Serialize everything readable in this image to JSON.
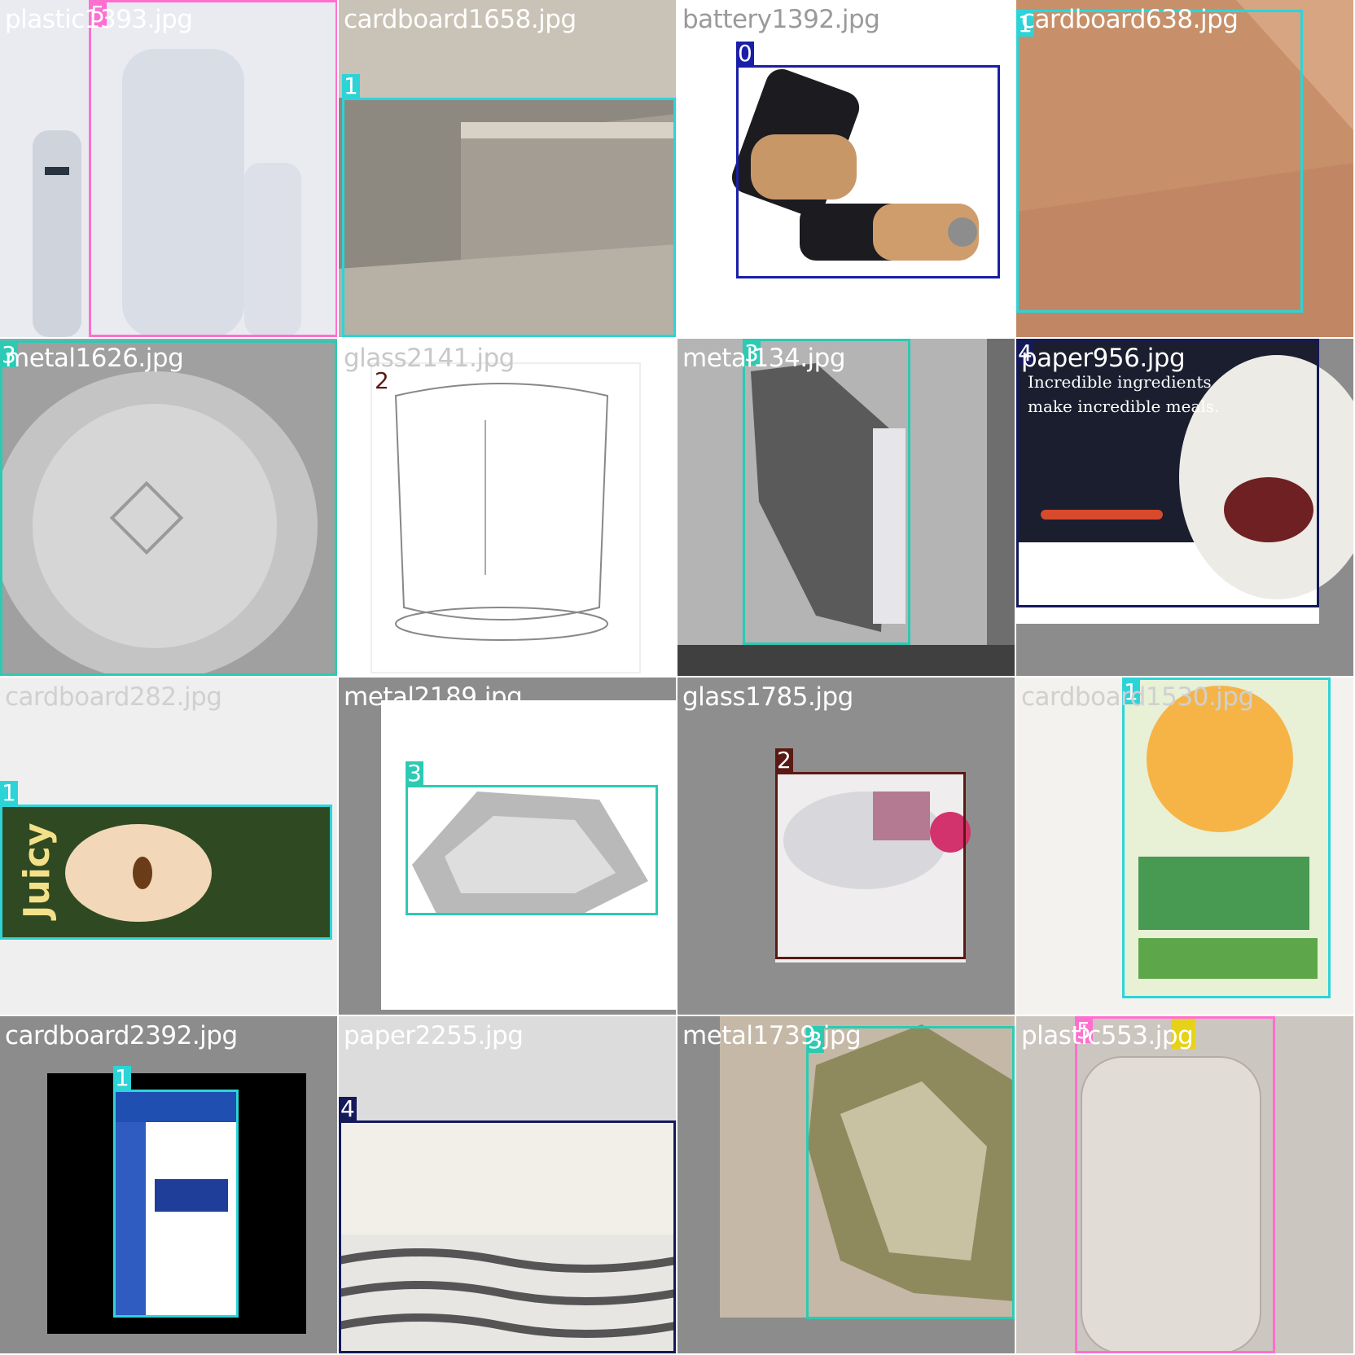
{
  "title": "",
  "class_colors": {
    "0": "#1a1fa8",
    "1": "#2cd4d8",
    "2": "#5a1a14",
    "3": "#2ccab3",
    "4": "#14195a",
    "5": "#ff6fd0"
  },
  "tiles": [
    {
      "filename": "plastic1393.jpg",
      "label_color": "#ffffff",
      "bg": "#e8e9ef",
      "boxes": [
        {
          "class_id": "5"
        }
      ]
    },
    {
      "filename": "cardboard1658.jpg",
      "label_color": "#ffffff",
      "bg": "#a8a39b",
      "boxes": [
        {
          "class_id": "1"
        }
      ]
    },
    {
      "filename": "battery1392.jpg",
      "label_color": "#9a9a9a",
      "bg": "#ffffff",
      "boxes": [
        {
          "class_id": "0"
        }
      ]
    },
    {
      "filename": "cardboard638.jpg",
      "label_color": "#ffffff",
      "bg": "#c48a64",
      "boxes": [
        {
          "class_id": "1"
        }
      ]
    },
    {
      "filename": "metal1626.jpg",
      "label_color": "#ffffff",
      "bg": "#9c9c9c",
      "boxes": [
        {
          "class_id": "3"
        }
      ]
    },
    {
      "filename": "glass2141.jpg",
      "label_color": "#c8c8c8",
      "bg": "#ffffff",
      "boxes": [
        {
          "class_id": "2"
        }
      ]
    },
    {
      "filename": "metal134.jpg",
      "label_color": "#ffffff",
      "bg": "#b4b4b4",
      "boxes": [
        {
          "class_id": "3"
        }
      ]
    },
    {
      "filename": "paper956.jpg",
      "label_color": "#ffffff",
      "bg": "#8c8c8c",
      "boxes": [
        {
          "class_id": "4"
        }
      ]
    },
    {
      "filename": "cardboard282.jpg",
      "label_color": "#d0d0d0",
      "bg": "#efefef",
      "boxes": [
        {
          "class_id": "1"
        }
      ]
    },
    {
      "filename": "metal2189.jpg",
      "label_color": "#ffffff",
      "bg": "#8c8c8c",
      "boxes": [
        {
          "class_id": "3"
        }
      ]
    },
    {
      "filename": "glass1785.jpg",
      "label_color": "#ffffff",
      "bg": "#8e8e8e",
      "boxes": [
        {
          "class_id": "2"
        }
      ]
    },
    {
      "filename": "cardboard1530.jpg",
      "label_color": "#d0d0d0",
      "bg": "#f4f2ee",
      "boxes": [
        {
          "class_id": "1"
        }
      ]
    },
    {
      "filename": "cardboard2392.jpg",
      "label_color": "#ffffff",
      "bg": "#8c8c8c",
      "boxes": [
        {
          "class_id": "1"
        }
      ]
    },
    {
      "filename": "paper2255.jpg",
      "label_color": "#ffffff",
      "bg": "#d4d4d4",
      "boxes": [
        {
          "class_id": "4"
        }
      ]
    },
    {
      "filename": "metal1739.jpg",
      "label_color": "#ffffff",
      "bg": "#8c8c8c",
      "boxes": [
        {
          "class_id": "3"
        }
      ]
    },
    {
      "filename": "plastic553.jpg",
      "label_color": "#ffffff",
      "bg": "#ccc6c0",
      "boxes": [
        {
          "class_id": "5"
        }
      ]
    }
  ]
}
